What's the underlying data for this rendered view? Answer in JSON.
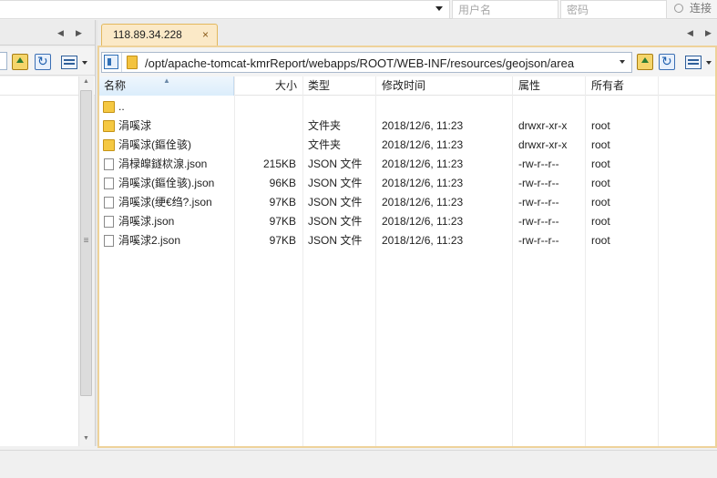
{
  "connection": {
    "host_placeholder": "",
    "user_placeholder": "用户名",
    "password_placeholder": "密码",
    "connect_label": "连接"
  },
  "remote": {
    "tab_label": "118.89.34.228",
    "tab_close": "×",
    "path": "/opt/apache-tomcat-kmrReport/webapps/ROOT/WEB-INF/resources/geojson/area",
    "columns": {
      "name": "名称",
      "size": "大小",
      "type": "类型",
      "modified": "修改时间",
      "attributes": "属性",
      "owner": "所有者"
    },
    "rows": [
      {
        "icon": "parent-folder-icon",
        "name": "..",
        "size": "",
        "type": "",
        "modified": "",
        "attributes": "",
        "owner": ""
      },
      {
        "icon": "folder-icon",
        "name": "涓嗘浗",
        "size": "",
        "type": "文件夹",
        "modified": "2018/12/6, 11:23",
        "attributes": "drwxr-xr-x",
        "owner": "root"
      },
      {
        "icon": "folder-icon",
        "name": "涓嗘浗(鏂佺骇)",
        "size": "",
        "type": "文件夹",
        "modified": "2018/12/6, 11:23",
        "attributes": "drwxr-xr-x",
        "owner": "root"
      },
      {
        "icon": "file-icon",
        "name": "涓椂皡鐩栨湶.json",
        "size": "215KB",
        "type": "JSON 文件",
        "modified": "2018/12/6, 11:23",
        "attributes": "-rw-r--r--",
        "owner": "root"
      },
      {
        "icon": "file-icon",
        "name": "涓嗘浗(鏂佺骇).json",
        "size": "96KB",
        "type": "JSON 文件",
        "modified": "2018/12/6, 11:23",
        "attributes": "-rw-r--r--",
        "owner": "root"
      },
      {
        "icon": "file-icon",
        "name": "涓嗘浗(绠€绉?.json",
        "size": "97KB",
        "type": "JSON 文件",
        "modified": "2018/12/6, 11:23",
        "attributes": "-rw-r--r--",
        "owner": "root"
      },
      {
        "icon": "file-icon",
        "name": "涓嗘浗.json",
        "size": "97KB",
        "type": "JSON 文件",
        "modified": "2018/12/6, 11:23",
        "attributes": "-rw-r--r--",
        "owner": "root"
      },
      {
        "icon": "file-icon",
        "name": "涓嗘浗2.json",
        "size": "97KB",
        "type": "JSON 文件",
        "modified": "2018/12/6, 11:23",
        "attributes": "-rw-r--r--",
        "owner": "root"
      }
    ]
  },
  "icons": {
    "nav_prev": "◀",
    "nav_next": "▶",
    "scroll_up": "▲",
    "scroll_down": "▼",
    "scroll_grip": "≡",
    "sort_up": "▲"
  }
}
